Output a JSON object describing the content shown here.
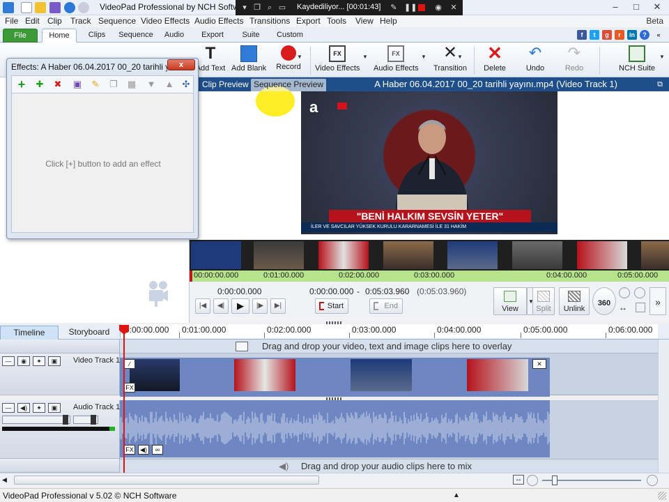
{
  "window": {
    "title": "VideoPad Professional by NCH Software",
    "beta": "Beta"
  },
  "recorder": {
    "status": "Kaydediliyor... [00:01:43]"
  },
  "menu": [
    "File",
    "Edit",
    "Clip",
    "Track",
    "Sequence",
    "Video Effects",
    "Audio Effects",
    "Transitions",
    "Export",
    "Tools",
    "View",
    "Help"
  ],
  "ribbon_tabs": [
    "File",
    "Home",
    "Clips",
    "Sequence",
    "Audio",
    "Export",
    "Suite",
    "Custom"
  ],
  "toolbar": {
    "add_text": "Add Text",
    "add_blank": "Add Blank",
    "record": "Record",
    "video_effects": "Video Effects",
    "audio_effects": "Audio Effects",
    "transition": "Transition",
    "delete": "Delete",
    "undo": "Undo",
    "redo": "Redo",
    "nch_suite": "NCH Suite"
  },
  "effects_dialog": {
    "title": "Effects: A Haber 06.04.2017 00_20 tarihli ya...",
    "empty_hint": "Click [+] button to add an effect",
    "close_label": "x"
  },
  "preview": {
    "tab_clip": "Clip Preview",
    "tab_sequence": "Sequence Preview",
    "title": "A Haber 06.04.2017 00_20 tarihli yayını.mp4 (Video Track 1)",
    "banner": "\"BENİ HALKIM SEVSİN YETER\"",
    "ticker": "İLER VE SAVCILAR YÜKSEK KURULU KARARNAMESİ İLE 31 HAKİM",
    "logo": "a"
  },
  "preview_ruler": [
    "00:00:00.000",
    "0:01:00.000",
    "0:02:00.000",
    "0:03:00.000",
    "0:04:00.000",
    "0:05:00.000"
  ],
  "transport": {
    "current_time": "0:00:00.000",
    "range_start": "0:00:00.000",
    "range_sep": "-",
    "range_end": "0:05:03.960",
    "duration": "(0:05:03.960)",
    "start_label": "Start",
    "end_label": "End",
    "view_label": "View",
    "split_label": "Split",
    "unlink_label": "Unlink",
    "deg_label": "360"
  },
  "timeline": {
    "tab_timeline": "Timeline",
    "tab_storyboard": "Storyboard",
    "ruler": [
      "0:00:00.000",
      "0:01:00.000",
      "0:02:00.000",
      "0:03:00.000",
      "0:04:00.000",
      "0:05:00.000",
      "0:06:00.000"
    ],
    "overlay_hint": "Drag and drop your video, text and image clips here to overlay",
    "video_track": "Video Track 1",
    "audio_track": "Audio Track 1",
    "audio_hint": "Drag and drop your audio clips here to mix"
  },
  "status": {
    "text": "VideoPad Professional v 5.02 © NCH Software"
  },
  "colors": {
    "accent": "#1f4f8a",
    "file_tab": "#3c9a37",
    "clip": "#6e87c2",
    "playhead": "#e01212"
  }
}
